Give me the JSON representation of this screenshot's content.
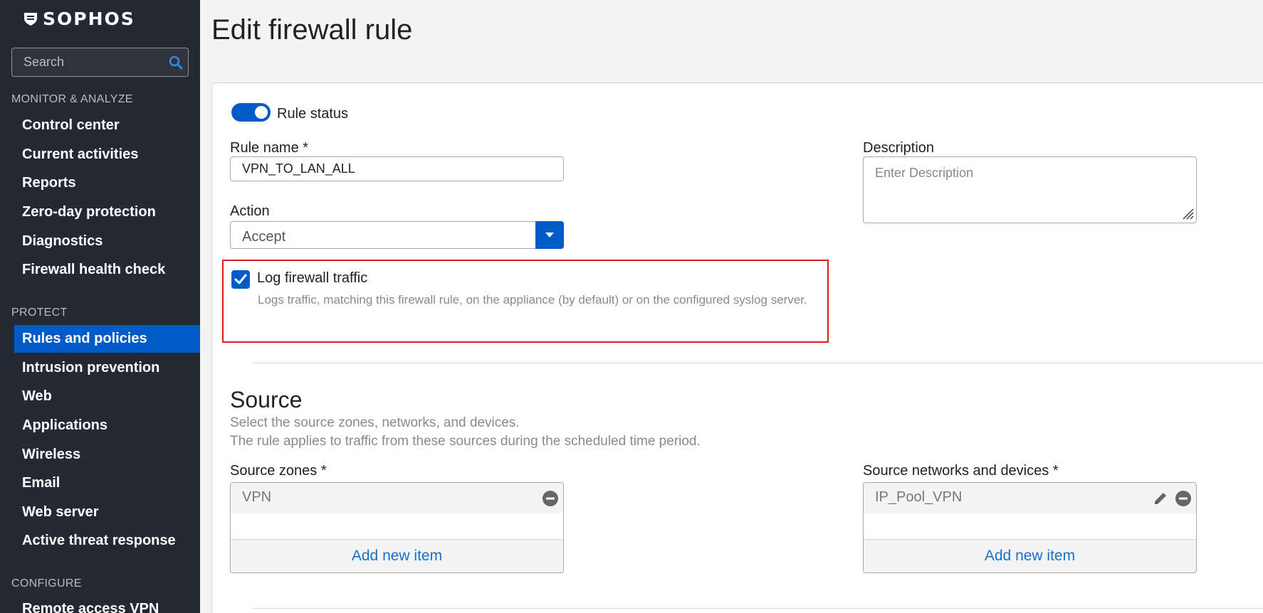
{
  "brand": {
    "name": "SOPHOS"
  },
  "search": {
    "placeholder": "Search"
  },
  "nav": {
    "sections": [
      {
        "label": "MONITOR & ANALYZE"
      },
      {
        "label": "PROTECT"
      },
      {
        "label": "CONFIGURE"
      }
    ],
    "items": [
      {
        "label": "Control center"
      },
      {
        "label": "Current activities"
      },
      {
        "label": "Reports"
      },
      {
        "label": "Zero-day protection"
      },
      {
        "label": "Diagnostics"
      },
      {
        "label": "Firewall health check"
      },
      {
        "label": "Rules and policies",
        "active": true
      },
      {
        "label": "Intrusion prevention"
      },
      {
        "label": "Web"
      },
      {
        "label": "Applications"
      },
      {
        "label": "Wireless"
      },
      {
        "label": "Email"
      },
      {
        "label": "Web server"
      },
      {
        "label": "Active threat response"
      },
      {
        "label": "Remote access VPN"
      }
    ]
  },
  "page": {
    "title": "Edit firewall rule"
  },
  "form": {
    "rule_status": {
      "label": "Rule status",
      "enabled": true
    },
    "rule_name": {
      "label": "Rule name *",
      "value": "VPN_TO_LAN_ALL"
    },
    "description": {
      "label": "Description",
      "placeholder": "Enter Description"
    },
    "action": {
      "label": "Action",
      "value": "Accept"
    },
    "log_traffic": {
      "label": "Log firewall traffic",
      "checked": true,
      "help": "Logs traffic, matching this firewall rule, on the appliance (by default) or on the configured syslog server."
    }
  },
  "source": {
    "title": "Source",
    "desc1": "Select the source zones, networks, and devices.",
    "desc2": "The rule applies to traffic from these sources during the scheduled time period.",
    "zones": {
      "label": "Source zones *",
      "items": [
        "VPN"
      ],
      "add_label": "Add new item"
    },
    "networks": {
      "label": "Source networks and devices *",
      "items": [
        "IP_Pool_VPN"
      ],
      "add_label": "Add new item"
    }
  },
  "colors": {
    "accent": "#005bc8",
    "sidebar": "#232a33",
    "highlight": "#e11d22"
  }
}
